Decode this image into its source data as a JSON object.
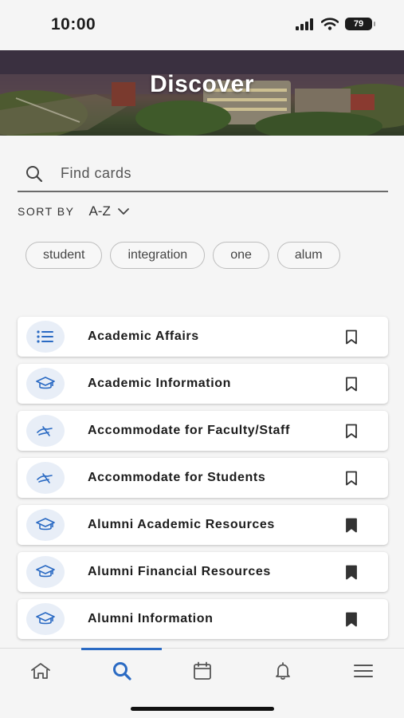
{
  "status": {
    "time": "10:00",
    "battery": "79"
  },
  "hero": {
    "title": "Discover"
  },
  "search": {
    "placeholder": "Find cards"
  },
  "sort": {
    "label": "SORT BY",
    "value": "A-Z"
  },
  "chips": [
    "student",
    "integration",
    "one",
    "alum"
  ],
  "cards": [
    {
      "title": "Academic Affairs",
      "icon": "list-icon",
      "bookmarked": false
    },
    {
      "title": "Academic Information",
      "icon": "graduation-cap-icon",
      "bookmarked": false
    },
    {
      "title": "Accommodate for Faculty/Staff",
      "icon": "accessibility-hand-icon",
      "bookmarked": false
    },
    {
      "title": "Accommodate for Students",
      "icon": "accessibility-hand-icon",
      "bookmarked": false
    },
    {
      "title": "Alumni Academic Resources",
      "icon": "graduation-cap-icon",
      "bookmarked": true
    },
    {
      "title": "Alumni Financial Resources",
      "icon": "graduation-cap-icon",
      "bookmarked": true
    },
    {
      "title": "Alumni Information",
      "icon": "graduation-cap-icon",
      "bookmarked": true
    }
  ],
  "tabs": [
    {
      "icon": "home-icon",
      "active": false
    },
    {
      "icon": "search-icon",
      "active": true
    },
    {
      "icon": "calendar-icon",
      "active": false
    },
    {
      "icon": "bell-icon",
      "active": false
    },
    {
      "icon": "menu-icon",
      "active": false
    }
  ],
  "colors": {
    "accent": "#2a6ac3",
    "icon_bg": "#e8eef7",
    "text": "#1c1c1c"
  }
}
